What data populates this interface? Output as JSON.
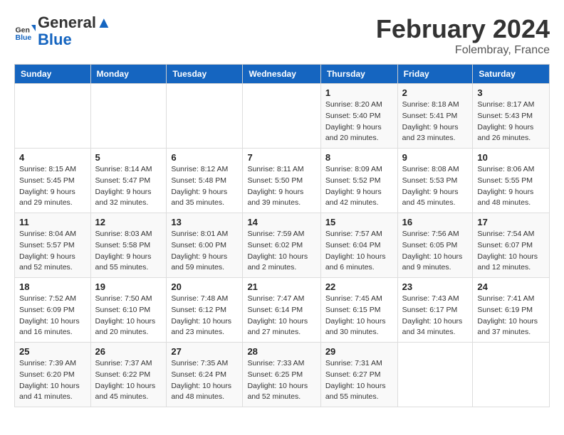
{
  "header": {
    "logo_line1": "General",
    "logo_line2": "Blue",
    "month": "February 2024",
    "location": "Folembray, France"
  },
  "columns": [
    "Sunday",
    "Monday",
    "Tuesday",
    "Wednesday",
    "Thursday",
    "Friday",
    "Saturday"
  ],
  "weeks": [
    [
      {
        "day": "",
        "info": ""
      },
      {
        "day": "",
        "info": ""
      },
      {
        "day": "",
        "info": ""
      },
      {
        "day": "",
        "info": ""
      },
      {
        "day": "1",
        "info": "Sunrise: 8:20 AM\nSunset: 5:40 PM\nDaylight: 9 hours\nand 20 minutes."
      },
      {
        "day": "2",
        "info": "Sunrise: 8:18 AM\nSunset: 5:41 PM\nDaylight: 9 hours\nand 23 minutes."
      },
      {
        "day": "3",
        "info": "Sunrise: 8:17 AM\nSunset: 5:43 PM\nDaylight: 9 hours\nand 26 minutes."
      }
    ],
    [
      {
        "day": "4",
        "info": "Sunrise: 8:15 AM\nSunset: 5:45 PM\nDaylight: 9 hours\nand 29 minutes."
      },
      {
        "day": "5",
        "info": "Sunrise: 8:14 AM\nSunset: 5:47 PM\nDaylight: 9 hours\nand 32 minutes."
      },
      {
        "day": "6",
        "info": "Sunrise: 8:12 AM\nSunset: 5:48 PM\nDaylight: 9 hours\nand 35 minutes."
      },
      {
        "day": "7",
        "info": "Sunrise: 8:11 AM\nSunset: 5:50 PM\nDaylight: 9 hours\nand 39 minutes."
      },
      {
        "day": "8",
        "info": "Sunrise: 8:09 AM\nSunset: 5:52 PM\nDaylight: 9 hours\nand 42 minutes."
      },
      {
        "day": "9",
        "info": "Sunrise: 8:08 AM\nSunset: 5:53 PM\nDaylight: 9 hours\nand 45 minutes."
      },
      {
        "day": "10",
        "info": "Sunrise: 8:06 AM\nSunset: 5:55 PM\nDaylight: 9 hours\nand 48 minutes."
      }
    ],
    [
      {
        "day": "11",
        "info": "Sunrise: 8:04 AM\nSunset: 5:57 PM\nDaylight: 9 hours\nand 52 minutes."
      },
      {
        "day": "12",
        "info": "Sunrise: 8:03 AM\nSunset: 5:58 PM\nDaylight: 9 hours\nand 55 minutes."
      },
      {
        "day": "13",
        "info": "Sunrise: 8:01 AM\nSunset: 6:00 PM\nDaylight: 9 hours\nand 59 minutes."
      },
      {
        "day": "14",
        "info": "Sunrise: 7:59 AM\nSunset: 6:02 PM\nDaylight: 10 hours\nand 2 minutes."
      },
      {
        "day": "15",
        "info": "Sunrise: 7:57 AM\nSunset: 6:04 PM\nDaylight: 10 hours\nand 6 minutes."
      },
      {
        "day": "16",
        "info": "Sunrise: 7:56 AM\nSunset: 6:05 PM\nDaylight: 10 hours\nand 9 minutes."
      },
      {
        "day": "17",
        "info": "Sunrise: 7:54 AM\nSunset: 6:07 PM\nDaylight: 10 hours\nand 12 minutes."
      }
    ],
    [
      {
        "day": "18",
        "info": "Sunrise: 7:52 AM\nSunset: 6:09 PM\nDaylight: 10 hours\nand 16 minutes."
      },
      {
        "day": "19",
        "info": "Sunrise: 7:50 AM\nSunset: 6:10 PM\nDaylight: 10 hours\nand 20 minutes."
      },
      {
        "day": "20",
        "info": "Sunrise: 7:48 AM\nSunset: 6:12 PM\nDaylight: 10 hours\nand 23 minutes."
      },
      {
        "day": "21",
        "info": "Sunrise: 7:47 AM\nSunset: 6:14 PM\nDaylight: 10 hours\nand 27 minutes."
      },
      {
        "day": "22",
        "info": "Sunrise: 7:45 AM\nSunset: 6:15 PM\nDaylight: 10 hours\nand 30 minutes."
      },
      {
        "day": "23",
        "info": "Sunrise: 7:43 AM\nSunset: 6:17 PM\nDaylight: 10 hours\nand 34 minutes."
      },
      {
        "day": "24",
        "info": "Sunrise: 7:41 AM\nSunset: 6:19 PM\nDaylight: 10 hours\nand 37 minutes."
      }
    ],
    [
      {
        "day": "25",
        "info": "Sunrise: 7:39 AM\nSunset: 6:20 PM\nDaylight: 10 hours\nand 41 minutes."
      },
      {
        "day": "26",
        "info": "Sunrise: 7:37 AM\nSunset: 6:22 PM\nDaylight: 10 hours\nand 45 minutes."
      },
      {
        "day": "27",
        "info": "Sunrise: 7:35 AM\nSunset: 6:24 PM\nDaylight: 10 hours\nand 48 minutes."
      },
      {
        "day": "28",
        "info": "Sunrise: 7:33 AM\nSunset: 6:25 PM\nDaylight: 10 hours\nand 52 minutes."
      },
      {
        "day": "29",
        "info": "Sunrise: 7:31 AM\nSunset: 6:27 PM\nDaylight: 10 hours\nand 55 minutes."
      },
      {
        "day": "",
        "info": ""
      },
      {
        "day": "",
        "info": ""
      }
    ]
  ]
}
